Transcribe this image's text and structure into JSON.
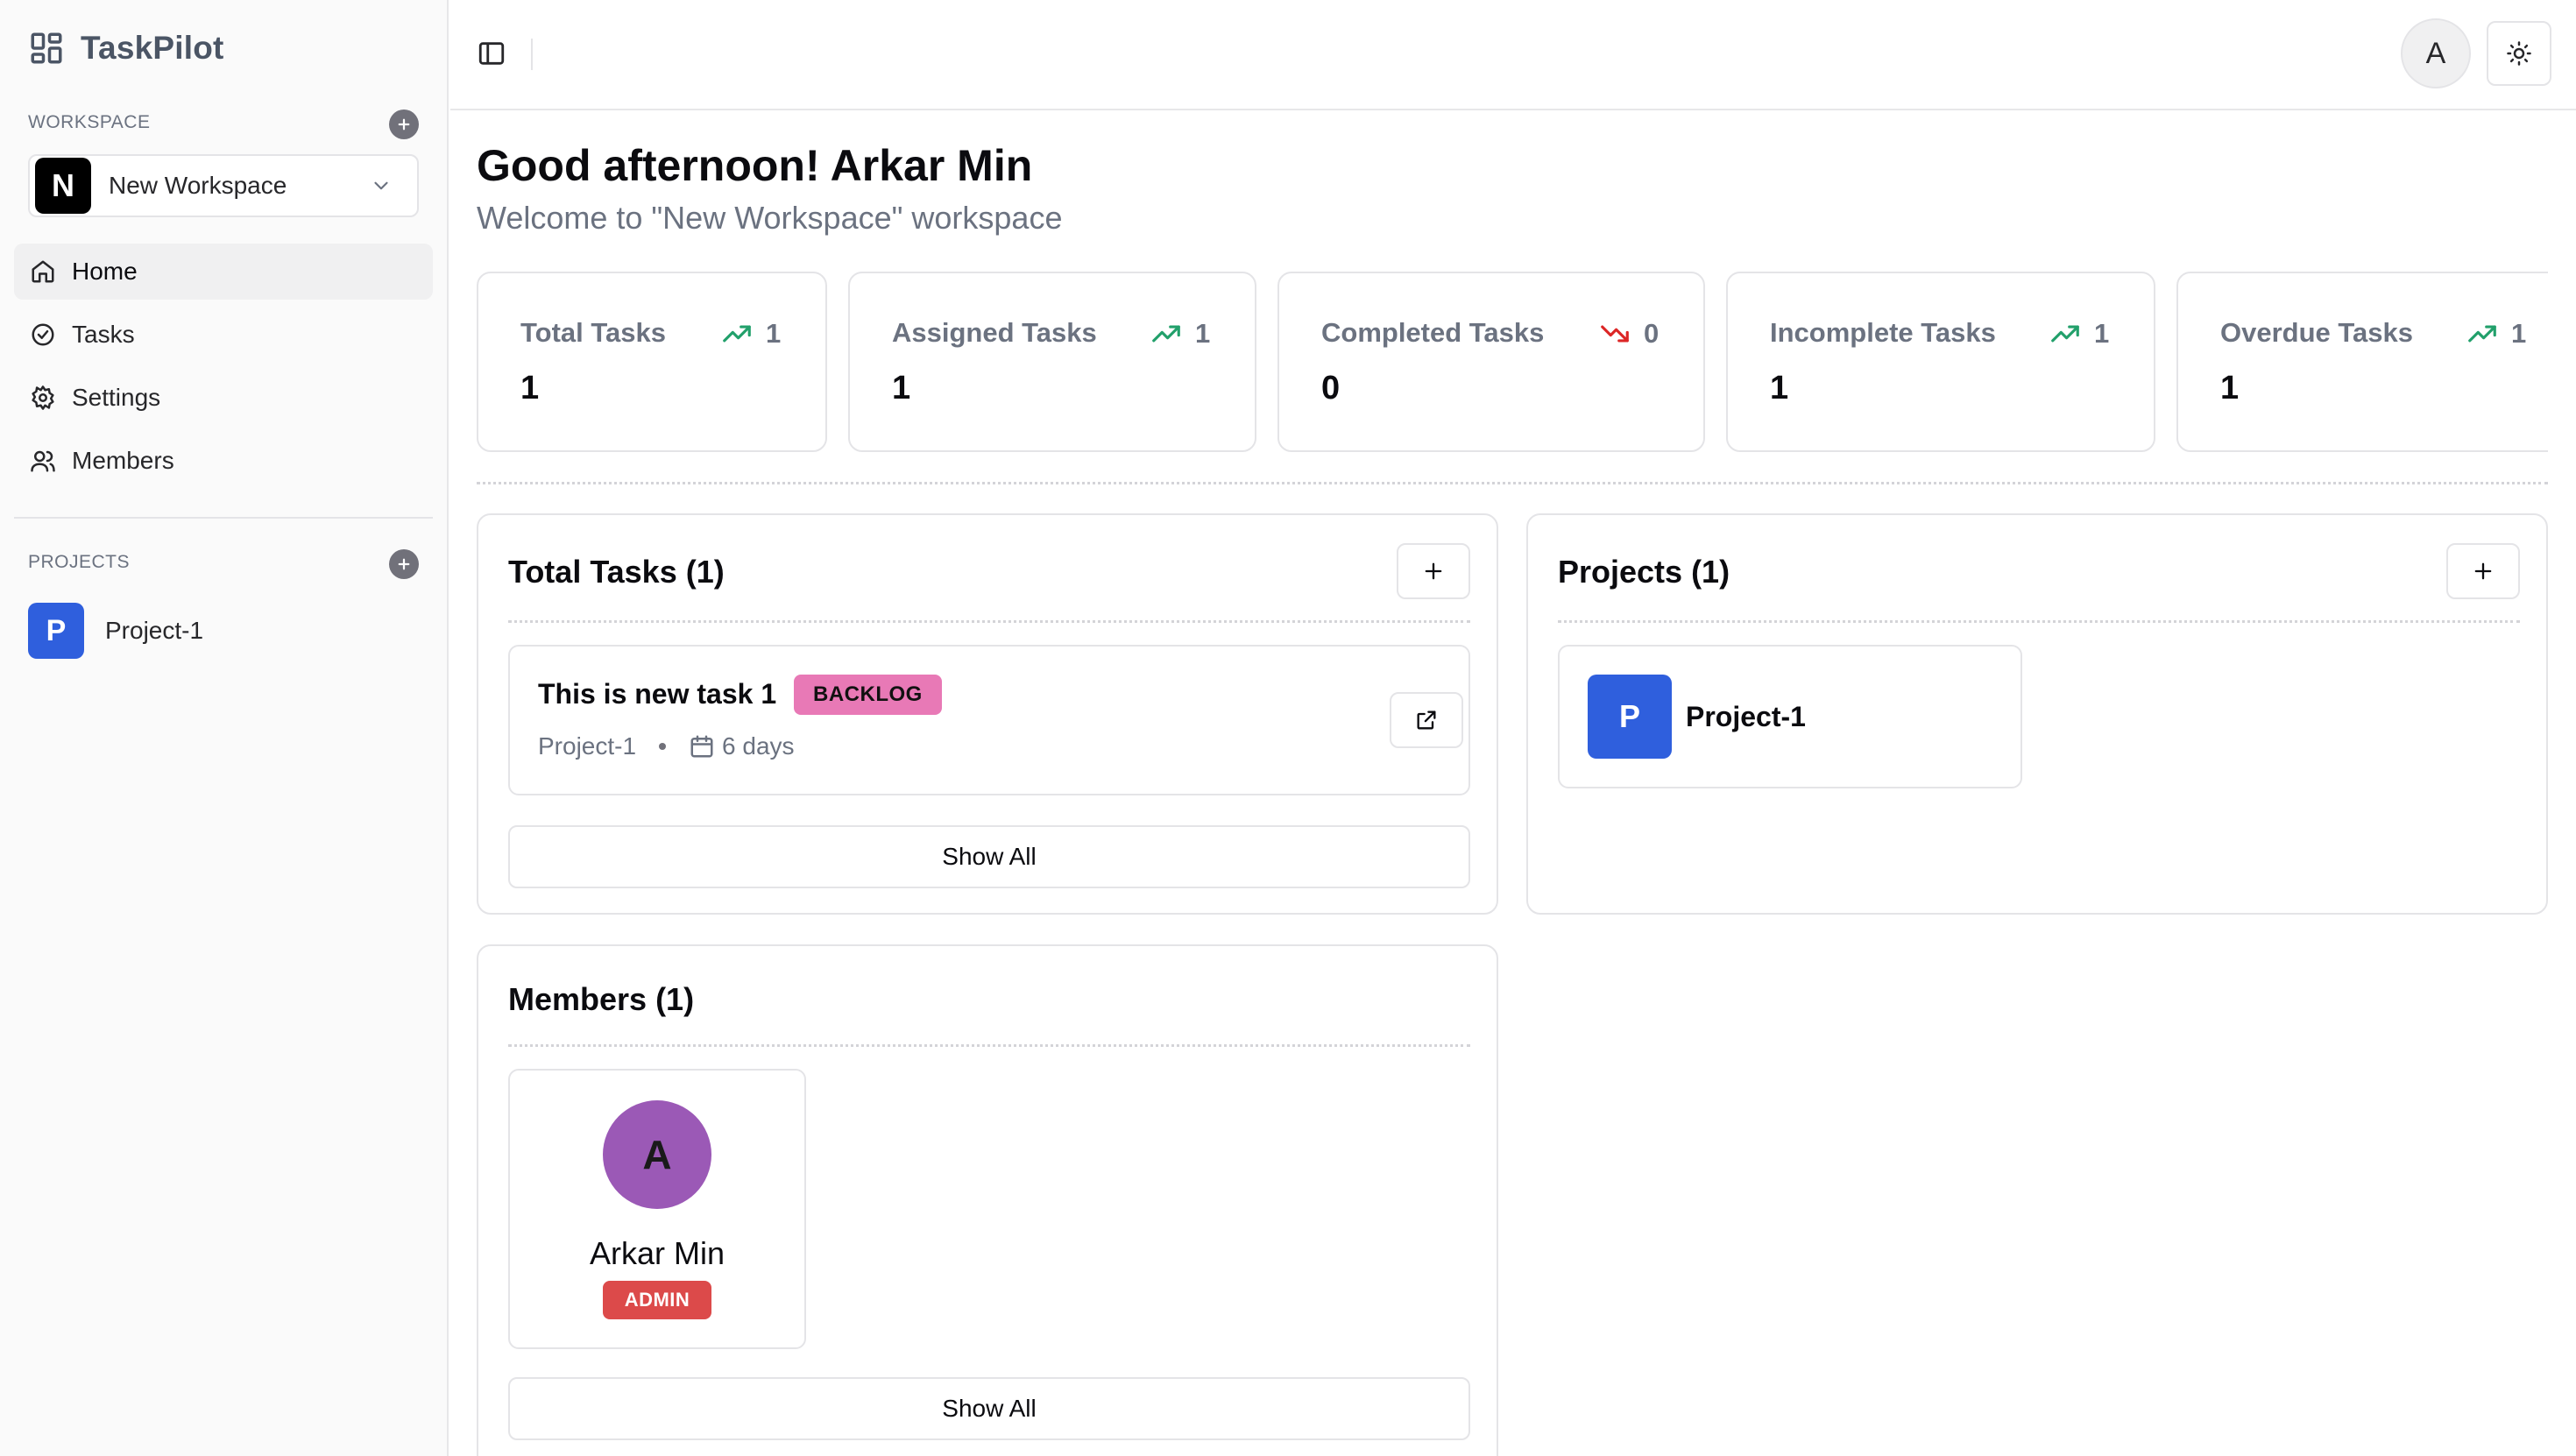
{
  "app": {
    "name": "TaskPilot"
  },
  "sidebar": {
    "workspace_label": "WORKSPACE",
    "workspace": {
      "initial": "N",
      "name": "New Workspace"
    },
    "nav": [
      {
        "label": "Home",
        "icon": "home-icon",
        "active": true
      },
      {
        "label": "Tasks",
        "icon": "check-circle-icon",
        "active": false
      },
      {
        "label": "Settings",
        "icon": "gear-icon",
        "active": false
      },
      {
        "label": "Members",
        "icon": "users-icon",
        "active": false
      }
    ],
    "projects_label": "PROJECTS",
    "projects": [
      {
        "initial": "P",
        "name": "Project-1"
      }
    ]
  },
  "topbar": {
    "user_initial": "A",
    "theme_icon": "sun-icon",
    "toggle_icon": "sidebar-toggle-icon"
  },
  "header": {
    "greeting": "Good afternoon! Arkar Min",
    "subtitle": "Welcome to \"New Workspace\" workspace"
  },
  "stats": [
    {
      "title": "Total Tasks",
      "trend": "up",
      "delta": "1",
      "value": "1"
    },
    {
      "title": "Assigned Tasks",
      "trend": "up",
      "delta": "1",
      "value": "1"
    },
    {
      "title": "Completed Tasks",
      "trend": "down",
      "delta": "0",
      "value": "0"
    },
    {
      "title": "Incomplete Tasks",
      "trend": "up",
      "delta": "1",
      "value": "1"
    },
    {
      "title": "Overdue Tasks",
      "trend": "up",
      "delta": "1",
      "value": "1"
    }
  ],
  "colors": {
    "trend_up": "#22a06b",
    "trend_down": "#dc2626",
    "project_accent": "#2f5fdd",
    "member_avatar": "#9b59b6",
    "admin_badge": "#dc4a4a",
    "backlog_badge": "#e879b6"
  },
  "tasks_panel": {
    "title": "Total Tasks (1)",
    "tasks": [
      {
        "name": "This is new task 1",
        "status": "BACKLOG",
        "project": "Project-1",
        "due": "6 days"
      }
    ],
    "show_all": "Show All"
  },
  "projects_panel": {
    "title": "Projects (1)",
    "projects": [
      {
        "initial": "P",
        "name": "Project-1"
      }
    ]
  },
  "members_panel": {
    "title": "Members (1)",
    "members": [
      {
        "initial": "A",
        "name": "Arkar Min",
        "role": "ADMIN"
      }
    ],
    "show_all": "Show All"
  }
}
